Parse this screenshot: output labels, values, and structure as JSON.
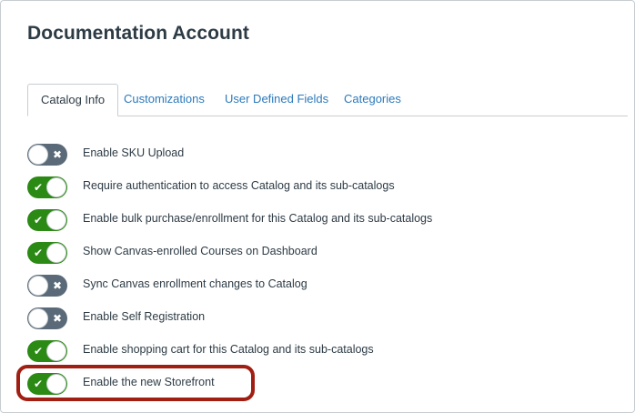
{
  "page": {
    "title": "Documentation Account"
  },
  "tabs": [
    {
      "label": "Catalog Info",
      "active": true
    },
    {
      "label": "Customizations",
      "active": false
    },
    {
      "label": "User Defined Fields",
      "active": false
    },
    {
      "label": "Categories",
      "active": false
    }
  ],
  "settings": [
    {
      "label": "Enable SKU Upload",
      "enabled": false
    },
    {
      "label": "Require authentication to access Catalog and its sub-catalogs",
      "enabled": true
    },
    {
      "label": "Enable bulk purchase/enrollment for this Catalog and its sub-catalogs",
      "enabled": true
    },
    {
      "label": "Show Canvas-enrolled Courses on Dashboard",
      "enabled": true
    },
    {
      "label": "Sync Canvas enrollment changes to Catalog",
      "enabled": false
    },
    {
      "label": "Enable Self Registration",
      "enabled": false
    },
    {
      "label": "Enable shopping cart for this Catalog and its sub-catalogs",
      "enabled": true
    },
    {
      "label": "Enable the new Storefront",
      "enabled": true,
      "highlighted": true
    }
  ],
  "colors": {
    "toggle_on": "#2b8a14",
    "toggle_off": "#5b6a78",
    "link": "#2b7abc",
    "highlight_border": "#a01e12"
  },
  "icons": {
    "on": "check-icon",
    "off": "x-icon"
  }
}
